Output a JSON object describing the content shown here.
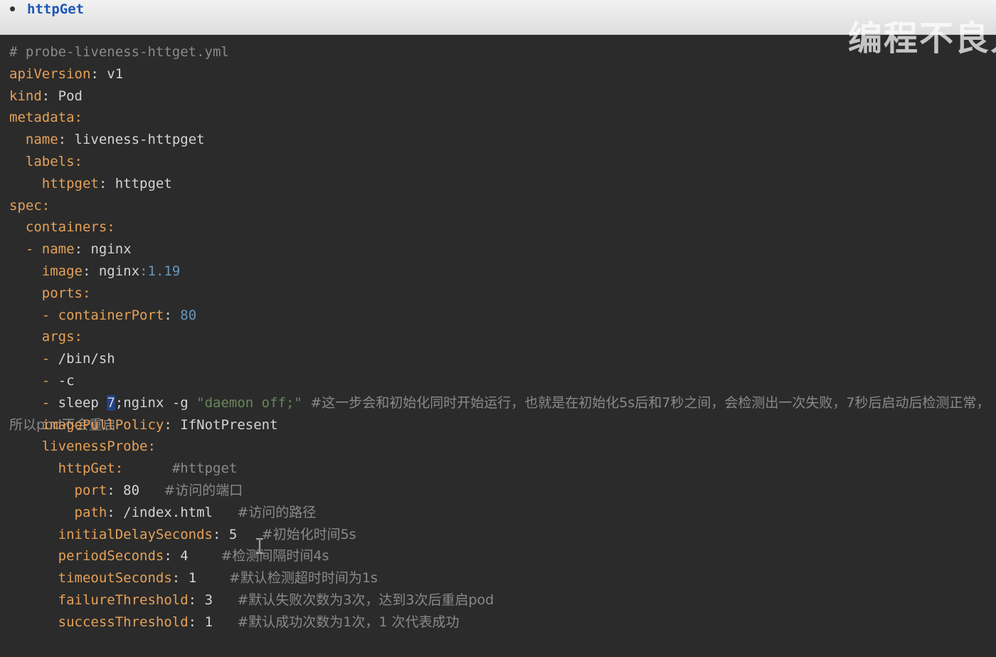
{
  "header": {
    "bullet_text": "httpGet",
    "watermark": "编程不良人"
  },
  "code": {
    "l1": "# probe-liveness-httget.yml",
    "l2_key": "apiVersion",
    "l2_val": "v1",
    "l3_key": "kind",
    "l3_val": "Pod",
    "l4_key": "metadata",
    "l5_key": "name",
    "l5_val": "liveness-httpget",
    "l6_key": "labels",
    "l7_key": "httpget",
    "l7_val": "httpget",
    "l8_key": "spec",
    "l9_key": "containers",
    "l10_dash": "-",
    "l10_key": "name",
    "l10_val": "nginx",
    "l11_key": "image",
    "l11_val": "nginx",
    "l11_num": "1.19",
    "l12_key": "ports",
    "l13_dash": "-",
    "l13_key": "containerPort",
    "l13_num": "80",
    "l14_key": "args",
    "l15_dash": "-",
    "l15_val": "/bin/sh",
    "l16_dash": "-",
    "l16_val": "-c",
    "l17_dash": "-",
    "l17_pre": "sleep ",
    "l17_sel": "7",
    "l17_mid": ";nginx -g ",
    "l17_str": "\"daemon off;\"",
    "l17_comment": "#这一步会和初始化同时开始运行，也就是在初始化5s后和7秒之间，会检测出一次失败，7秒后启动后检测正常，所以pod不会重启",
    "l18_key": "imagePullPolicy",
    "l18_val": "IfNotPresent",
    "l19_key": "livenessProbe",
    "l20_key": "httpGet",
    "l20_comment": "#httpget",
    "l21_key": "port",
    "l21_val": "80",
    "l21_comment": "#访问的端口",
    "l22_key": "path",
    "l22_val": "/index.html",
    "l22_comment": "#访问的路径",
    "l23_key": "initialDelaySeconds",
    "l23_val": "5",
    "l23_comment": "#初始化时间5s",
    "l24_key": "periodSeconds",
    "l24_val": "4",
    "l24_comment": "#检测间隔时间4s",
    "l25_key": "timeoutSeconds",
    "l25_val": "1",
    "l25_comment": "#默认检测超时时间为1s",
    "l26_key": "failureThreshold",
    "l26_val": "3",
    "l26_comment": "#默认失败次数为3次，达到3次后重启pod",
    "l27_key": "successThreshold",
    "l27_val": "1",
    "l27_comment": "#默认成功次数为1次，1 次代表成功"
  }
}
